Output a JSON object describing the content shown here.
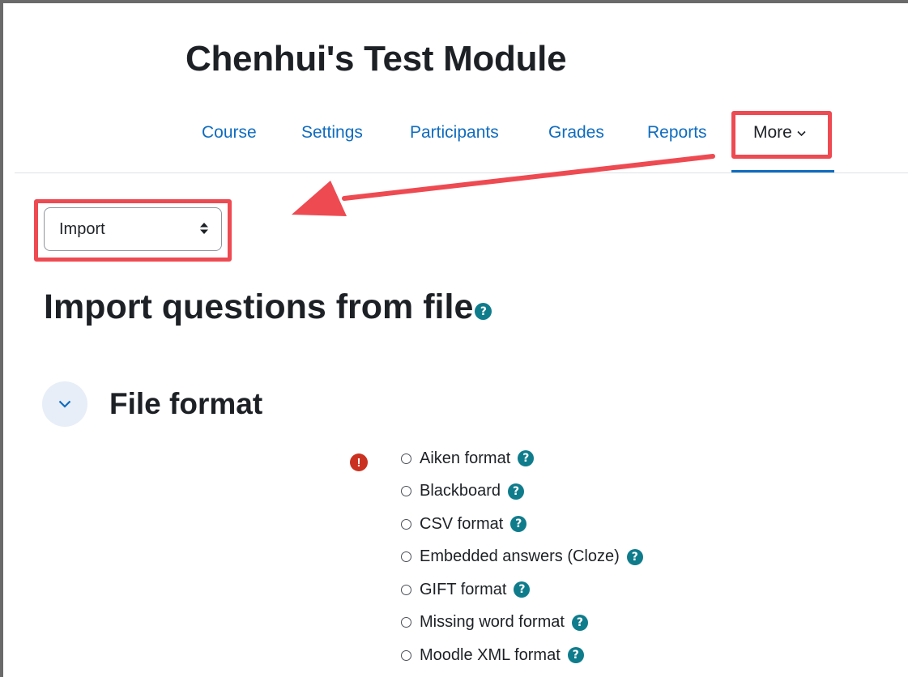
{
  "page": {
    "module_title": "Chenhui's Test Module",
    "heading": "Import questions from file"
  },
  "nav": {
    "tabs": [
      {
        "label": "Course"
      },
      {
        "label": "Settings"
      },
      {
        "label": "Participants"
      },
      {
        "label": "Grades"
      },
      {
        "label": "Reports"
      },
      {
        "label": "More"
      }
    ],
    "active_tab": "More"
  },
  "select": {
    "value": "Import"
  },
  "section": {
    "title": "File format",
    "options": [
      {
        "label": "Aiken format"
      },
      {
        "label": "Blackboard"
      },
      {
        "label": "CSV format"
      },
      {
        "label": "Embedded answers (Cloze)"
      },
      {
        "label": "GIFT format"
      },
      {
        "label": "Missing word format"
      },
      {
        "label": "Moodle XML format"
      }
    ]
  },
  "icons": {
    "help": "question-circle-icon",
    "required": "exclamation-circle-icon",
    "collapse": "chevron-down-icon",
    "dropdown": "up-down-arrows-icon"
  },
  "colors": {
    "link": "#0f6cbf",
    "help_icon": "#0f7c8c",
    "required_icon": "#ca3120",
    "annotation": "#ee4a52",
    "collapse_bg": "#e7eef7"
  }
}
